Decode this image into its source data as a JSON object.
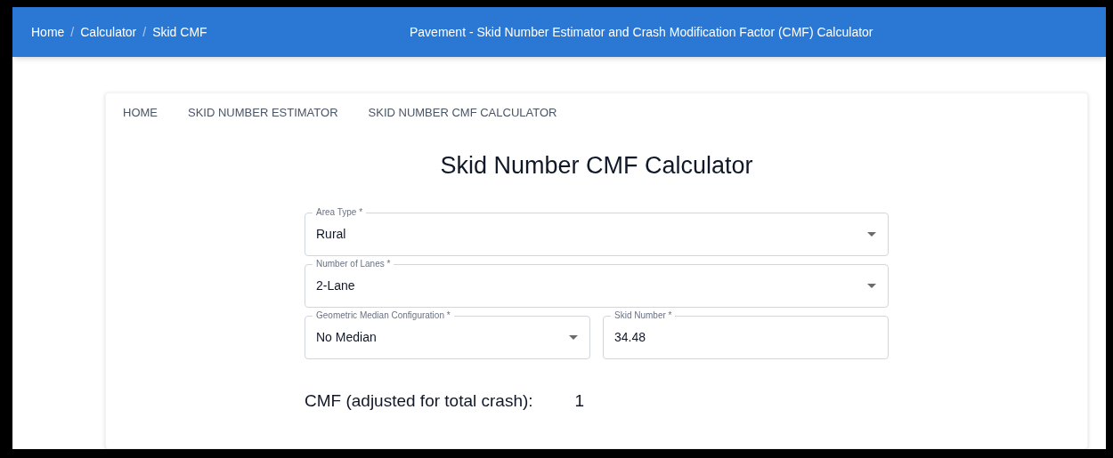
{
  "header": {
    "breadcrumb": [
      {
        "label": "Home"
      },
      {
        "label": "Calculator"
      },
      {
        "label": "Skid CMF"
      }
    ],
    "separator": "/",
    "title": "Pavement - Skid Number Estimator and Crash Modification Factor (CMF) Calculator"
  },
  "nav": [
    "HOME",
    "SKID NUMBER ESTIMATOR",
    "SKID NUMBER CMF CALCULATOR"
  ],
  "page_title": "Skid Number CMF Calculator",
  "fields": [
    {
      "kind": "select",
      "label": "Area Type *",
      "value": "Rural"
    },
    {
      "kind": "select",
      "label": "Number of Lanes *",
      "value": "2-Lane"
    },
    {
      "kind": "select",
      "label": "Geometric Median Configuration *",
      "value": "No Median"
    },
    {
      "kind": "input",
      "label": "Skid Number *",
      "value": "34.48"
    }
  ],
  "result": {
    "label": "CMF (adjusted for total crash):",
    "value": "1"
  }
}
